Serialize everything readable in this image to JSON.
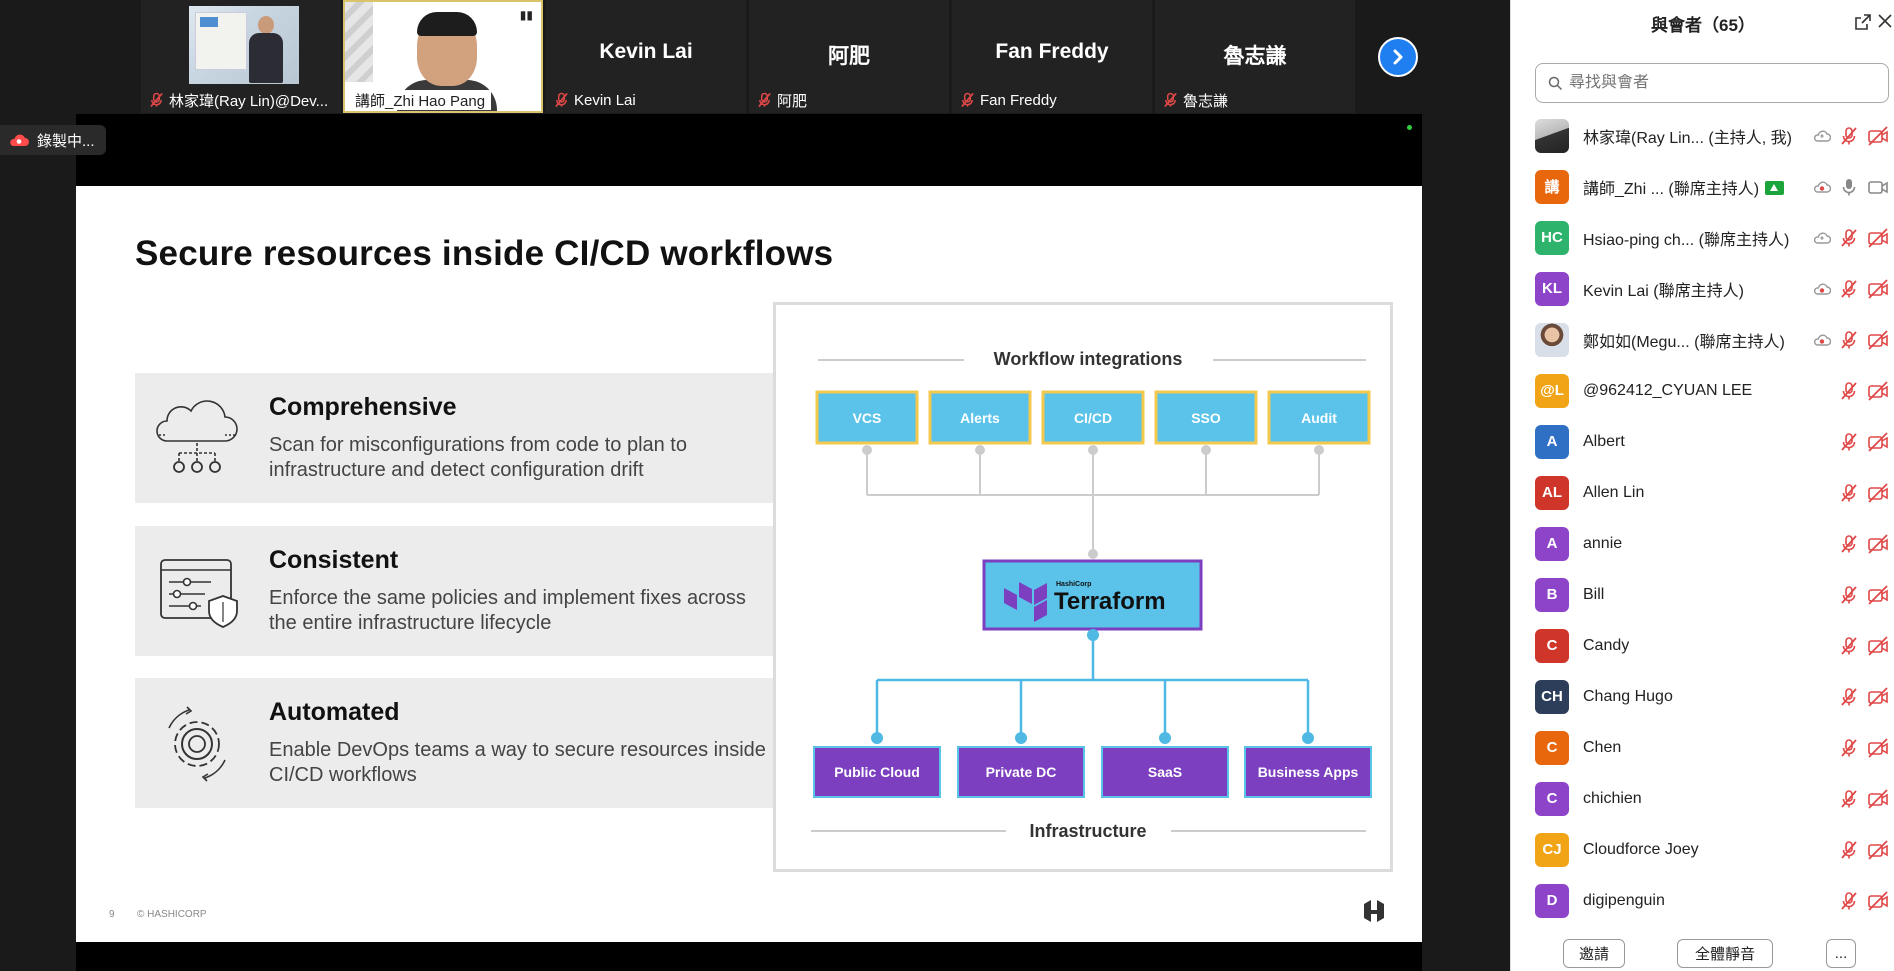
{
  "strip": {
    "tiles": [
      {
        "name": "林家瑋(Ray Lin)@Dev...",
        "muted": true
      },
      {
        "name": "講師_Zhi Hao Pang",
        "muted": false,
        "active": true
      },
      {
        "name": "Kevin Lai",
        "big_name": "Kevin Lai",
        "muted": true
      },
      {
        "name": "阿肥",
        "big_name": "阿肥",
        "muted": true
      },
      {
        "name": "Fan Freddy",
        "big_name": "Fan Freddy",
        "muted": true
      },
      {
        "name": "魯志謙",
        "big_name": "魯志謙",
        "muted": true
      }
    ],
    "next_icon": "chevron-right-icon"
  },
  "recording": {
    "label": "錄製中..."
  },
  "slide": {
    "title": "Secure resources inside CI/CD workflows",
    "features": [
      {
        "title": "Comprehensive",
        "desc": "Scan for misconfigurations from code to plan to infrastructure and detect configuration drift",
        "icon": "cloud-scan-icon"
      },
      {
        "title": "Consistent",
        "desc": "Enforce the same policies and implement fixes across the entire infrastructure lifecycle",
        "icon": "policy-shield-icon"
      },
      {
        "title": "Automated",
        "desc": "Enable DevOps teams a way to secure resources inside CI/CD workflows",
        "icon": "gear-cycle-icon"
      }
    ],
    "diagram": {
      "top_label": "Workflow integrations",
      "top_boxes": [
        "VCS",
        "Alerts",
        "CI/CD",
        "SSO",
        "Audit"
      ],
      "center_small": "HashiCorp",
      "center": "Terraform",
      "bottom_boxes": [
        "Public Cloud",
        "Private DC",
        "SaaS",
        "Business Apps"
      ],
      "bottom_label": "Infrastructure",
      "colors": {
        "top_fill": "#5bc3ea",
        "top_border": "#f2c94c",
        "bottom_fill": "#7b3fbf",
        "bottom_border": "#5bc3ea",
        "line_top": "#cccccc",
        "line_bottom": "#4fb9e3"
      }
    },
    "page_number": "9",
    "copyright": "© HASHICORP"
  },
  "panel": {
    "title": "與會者（65）",
    "search_placeholder": "尋找與會者",
    "participants": [
      {
        "initials": "",
        "photo": "photo1",
        "name": "林家瑋(Ray Lin...",
        "role": "(主持人, 我)",
        "color": "#888888",
        "icons": [
          "cloud",
          "mic-off",
          "video-off"
        ]
      },
      {
        "initials": "講",
        "name": "講師_Zhi ...",
        "role": "(聯席主持人)",
        "color": "#e8660c",
        "share": true,
        "icons": [
          "rec",
          "mic",
          "video"
        ]
      },
      {
        "initials": "HC",
        "name": "Hsiao-ping ch...",
        "role": "(聯席主持人)",
        "color": "#2db36b",
        "icons": [
          "cloud",
          "mic-off",
          "video-off"
        ]
      },
      {
        "initials": "KL",
        "name": "Kevin Lai",
        "role": "(聯席主持人)",
        "color": "#8e44c9",
        "icons": [
          "rec",
          "mic-off",
          "video-off"
        ]
      },
      {
        "initials": "",
        "photo": "photo2",
        "name": "鄭如如(Megu...",
        "role": "(聯席主持人)",
        "color": "#999999",
        "icons": [
          "rec",
          "mic-off",
          "video-off"
        ]
      },
      {
        "initials": "@L",
        "name": "@962412_CYUAN LEE",
        "role": "",
        "color": "#f2a417",
        "icons": [
          "mic-off",
          "video-off"
        ]
      },
      {
        "initials": "A",
        "name": "Albert",
        "role": "",
        "color": "#2f6fc4",
        "icons": [
          "mic-off",
          "video-off"
        ]
      },
      {
        "initials": "AL",
        "name": "Allen Lin",
        "role": "",
        "color": "#d0352a",
        "icons": [
          "mic-off",
          "video-off"
        ]
      },
      {
        "initials": "A",
        "name": "annie",
        "role": "",
        "color": "#8e44c9",
        "icons": [
          "mic-off",
          "video-off"
        ]
      },
      {
        "initials": "B",
        "name": "Bill",
        "role": "",
        "color": "#8e44c9",
        "icons": [
          "mic-off",
          "video-off"
        ]
      },
      {
        "initials": "C",
        "name": "Candy",
        "role": "",
        "color": "#d0352a",
        "icons": [
          "mic-off",
          "video-off"
        ]
      },
      {
        "initials": "CH",
        "name": "Chang Hugo",
        "role": "",
        "color": "#2c3e5a",
        "icons": [
          "mic-off",
          "video-off"
        ]
      },
      {
        "initials": "C",
        "name": "Chen",
        "role": "",
        "color": "#e8660c",
        "icons": [
          "mic-off",
          "video-off"
        ]
      },
      {
        "initials": "C",
        "name": "chichien",
        "role": "",
        "color": "#8e44c9",
        "icons": [
          "mic-off",
          "video-off"
        ]
      },
      {
        "initials": "CJ",
        "name": "Cloudforce Joey",
        "role": "",
        "color": "#f2a417",
        "icons": [
          "mic-off",
          "video-off"
        ]
      },
      {
        "initials": "D",
        "name": "digipenguin",
        "role": "",
        "color": "#8e44c9",
        "icons": [
          "mic-off",
          "video-off"
        ]
      }
    ],
    "footer": {
      "invite": "邀請",
      "mute_all": "全體靜音",
      "more": "..."
    }
  }
}
